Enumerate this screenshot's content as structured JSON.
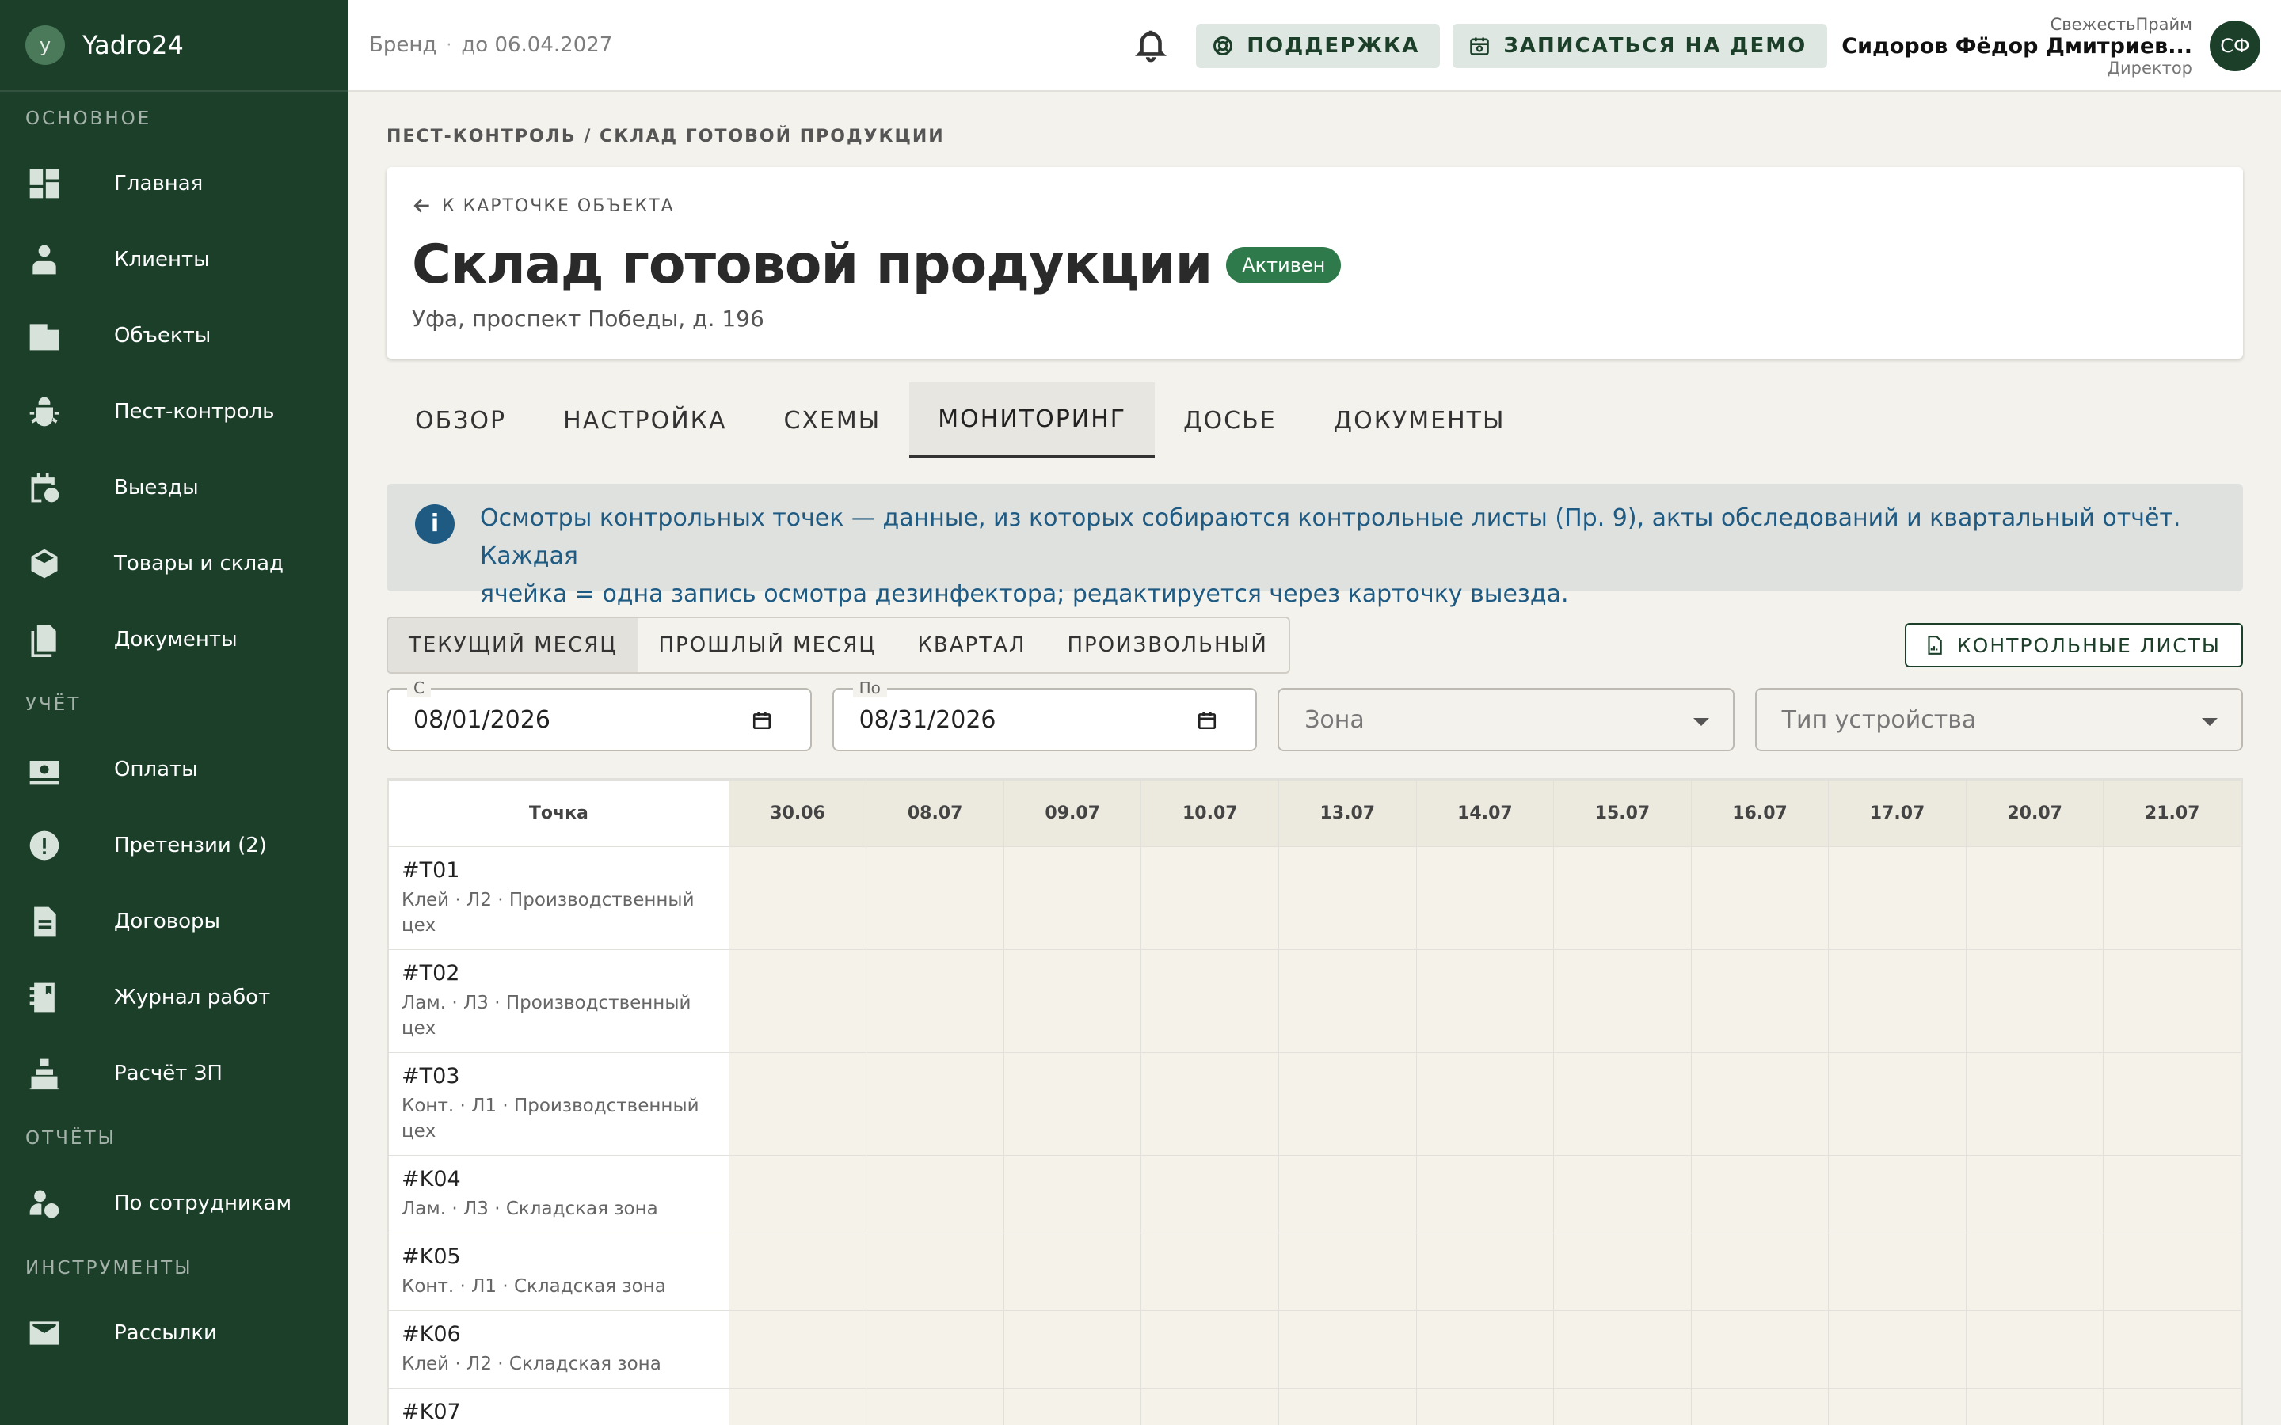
{
  "app": {
    "name": "Yadro24",
    "logo_letter": "y"
  },
  "topbar": {
    "brand": "Бренд",
    "until": "до 06.04.2027",
    "support_label": "ПОДДЕРЖКА",
    "demo_label": "ЗАПИСАТЬСЯ НА ДЕМО",
    "user_company": "СвежестьПрайм",
    "user_name": "Сидоров Фёдор Дмитриев...",
    "user_role": "Директор",
    "avatar_initials": "СФ"
  },
  "sidebar": {
    "sections": [
      {
        "title": "ОСНОВНОЕ",
        "items": [
          {
            "label": "Главная",
            "icon": "dashboard-icon"
          },
          {
            "label": "Клиенты",
            "icon": "users-icon"
          },
          {
            "label": "Объекты",
            "icon": "building-icon"
          },
          {
            "label": "Пест-контроль",
            "icon": "bug-icon"
          },
          {
            "label": "Выезды",
            "icon": "calendar-clock-icon"
          },
          {
            "label": "Товары и склад",
            "icon": "box-icon"
          },
          {
            "label": "Документы",
            "icon": "documents-icon"
          }
        ]
      },
      {
        "title": "УЧЁТ",
        "items": [
          {
            "label": "Оплаты",
            "icon": "cash-icon"
          },
          {
            "label": "Претензии (2)",
            "icon": "alert-icon"
          },
          {
            "label": "Договоры",
            "icon": "contract-icon"
          },
          {
            "label": "Журнал работ",
            "icon": "journal-icon"
          },
          {
            "label": "Расчёт ЗП",
            "icon": "register-icon"
          }
        ]
      },
      {
        "title": "ОТЧЁТЫ",
        "items": [
          {
            "label": "По сотрудникам",
            "icon": "employee-clock-icon"
          }
        ]
      },
      {
        "title": "ИНСТРУМЕНТЫ",
        "items": [
          {
            "label": "Рассылки",
            "icon": "mail-icon"
          }
        ]
      }
    ]
  },
  "breadcrumb": "ПЕСТ-КОНТРОЛЬ / СКЛАД ГОТОВОЙ ПРОДУКЦИИ",
  "header": {
    "back_label": "К КАРТОЧКЕ ОБЪЕКТА",
    "title": "Склад готовой продукции",
    "status": "Активен",
    "address": "Уфа, проспект Победы, д. 196"
  },
  "tabs": [
    "ОБЗОР",
    "НАСТРОЙКА",
    "СХЕМЫ",
    "МОНИТОРИНГ",
    "ДОСЬЕ",
    "ДОКУМЕНТЫ"
  ],
  "active_tab": "МОНИТОРИНГ",
  "info": {
    "line1": "Осмотры контрольных точек — данные, из которых собираются контрольные листы (Пр. 9), акты обследований и квартальный отчёт. Каждая",
    "line2": "ячейка = одна запись осмотра дезинфектора; редактируется через карточку выезда."
  },
  "periods": [
    "ТЕКУЩИЙ МЕСЯЦ",
    "ПРОШЛЫЙ МЕСЯЦ",
    "КВАРТАЛ",
    "ПРОИЗВОЛЬНЫЙ"
  ],
  "active_period": "ТЕКУЩИЙ МЕСЯЦ",
  "checklists_label": "КОНТРОЛЬНЫЕ ЛИСТЫ",
  "filters": {
    "from_label": "С",
    "from_value": "08/01/2026",
    "to_label": "По",
    "to_value": "08/31/2026",
    "zone_placeholder": "Зона",
    "device_placeholder": "Тип устройства"
  },
  "grid": {
    "point_header": "Точка",
    "dates": [
      "30.06",
      "08.07",
      "09.07",
      "10.07",
      "13.07",
      "14.07",
      "15.07",
      "16.07",
      "17.07",
      "20.07",
      "21.07"
    ],
    "rows": [
      {
        "id": "#T01",
        "desc": "Клей · Л2 · Производственный цех"
      },
      {
        "id": "#T02",
        "desc": "Лам. · Л3 · Производственный цех"
      },
      {
        "id": "#T03",
        "desc": "Конт. · Л1 · Производственный цех"
      },
      {
        "id": "#K04",
        "desc": "Лам. · Л3 · Складская зона"
      },
      {
        "id": "#K05",
        "desc": "Конт. · Л1 · Складская зона"
      },
      {
        "id": "#K06",
        "desc": "Клей · Л2 · Складская зона"
      },
      {
        "id": "#K07",
        "desc": ""
      }
    ]
  }
}
